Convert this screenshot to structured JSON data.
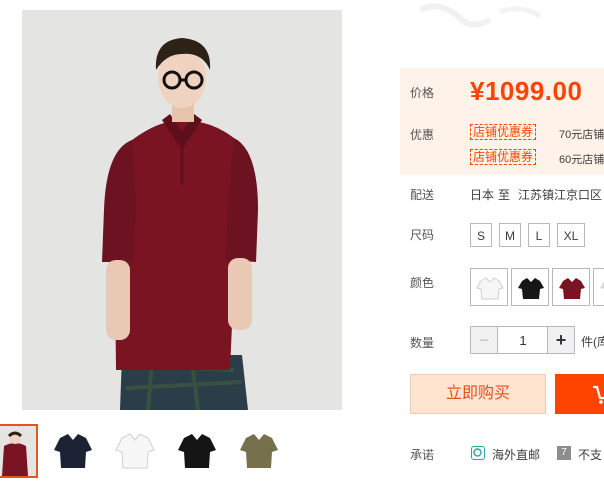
{
  "gallery": {
    "thumbnails": [
      {
        "label": "burgundy-polo-model",
        "color": "#7a1422",
        "active": true
      },
      {
        "label": "navy-polo",
        "color": "#1c2233",
        "active": false
      },
      {
        "label": "white-polo",
        "color": "#f4f4f4",
        "active": false
      },
      {
        "label": "black-polo",
        "color": "#151515",
        "active": false
      },
      {
        "label": "olive-polo",
        "color": "#76704c",
        "active": false
      }
    ]
  },
  "price": {
    "label": "价格",
    "currency": "¥",
    "value": "1099.00"
  },
  "promo": {
    "label": "优惠",
    "coupons": [
      {
        "tag": "店铺优惠券",
        "text": "70元店铺"
      },
      {
        "tag": "店铺优惠券",
        "text": "60元店铺"
      }
    ]
  },
  "delivery": {
    "label": "配送",
    "from": "日本",
    "to_word": "至",
    "dest": "江苏镇江京口区"
  },
  "size": {
    "label": "尺码",
    "options": [
      "S",
      "M",
      "L",
      "XL"
    ]
  },
  "color": {
    "label": "颜色",
    "swatches": [
      {
        "name": "white",
        "hex": "#f6f6f6"
      },
      {
        "name": "black",
        "hex": "#161616"
      },
      {
        "name": "burgundy",
        "hex": "#7a1422"
      },
      {
        "name": "grey",
        "hex": "#d8d8d8"
      }
    ]
  },
  "quantity": {
    "label": "数量",
    "minus": "−",
    "value": "1",
    "plus": "+",
    "unit": "件(库"
  },
  "actions": {
    "buy_now": "立即购买"
  },
  "promise": {
    "label": "承诺",
    "items": [
      {
        "icon": "globe-icon",
        "text": "海外直邮",
        "color": "#27a89b"
      },
      {
        "icon": "seven-icon",
        "text": "不支",
        "color": "#8d8d8d"
      }
    ]
  },
  "colors": {
    "accent": "#ff4400",
    "price_bg": "#fff2e8",
    "buy_bg": "#ffe4d0"
  }
}
